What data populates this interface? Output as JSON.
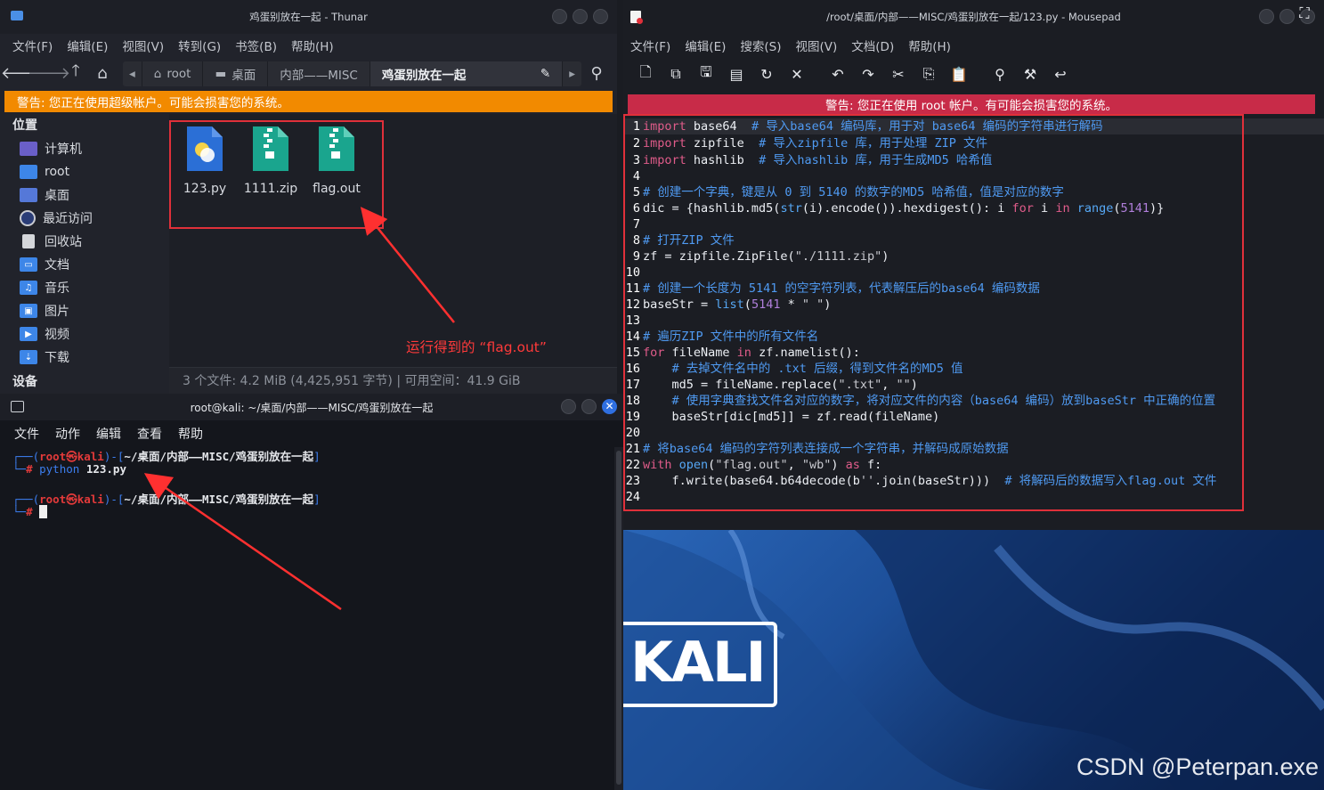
{
  "thunar": {
    "title": "鸡蛋别放在一起 - Thunar",
    "menu": [
      "文件(F)",
      "编辑(E)",
      "视图(V)",
      "转到(G)",
      "书签(B)",
      "帮助(H)"
    ],
    "breadcrumbs": [
      "root",
      "桌面",
      "内部——MISC",
      "鸡蛋别放在一起"
    ],
    "warning": "警告: 您正在使用超级帐户。可能会损害您的系统。",
    "places_header": "位置",
    "places": [
      "计算机",
      "root",
      "桌面",
      "最近访问",
      "回收站",
      "文档",
      "音乐",
      "图片",
      "视频",
      "下载"
    ],
    "devices_header": "设备",
    "files": [
      "123.py",
      "1111.zip",
      "flag.out"
    ],
    "status": "3 个文件: 4.2 MiB (4,425,951 字节)  |  可用空间：41.9 GiB",
    "annotation": "运行得到的 “flag.out”"
  },
  "mousepad": {
    "title": "/root/桌面/内部——MISC/鸡蛋别放在一起/123.py - Mousepad",
    "menu": [
      "文件(F)",
      "编辑(E)",
      "搜索(S)",
      "视图(V)",
      "文档(D)",
      "帮助(H)"
    ],
    "warning": "警告: 您正在使用 root 帐户。有可能会损害您的系统。",
    "line_numbers": [
      "1",
      "2",
      "3",
      "4",
      "5",
      "6",
      "7",
      "8",
      "9",
      "10",
      "11",
      "12",
      "13",
      "14",
      "15",
      "16",
      "17",
      "18",
      "19",
      "20",
      "21",
      "22",
      "23",
      "24"
    ],
    "code": {
      "l1": {
        "kw": "import",
        "rest": " base64  ",
        "cm": "# 导入base64 编码库，用于对 base64 编码的字符串进行解码"
      },
      "l2": {
        "kw": "import",
        "rest": " zipfile  ",
        "cm": "# 导入zipfile 库，用于处理 ZIP 文件"
      },
      "l3": {
        "kw": "import",
        "rest": " hashlib  ",
        "cm": "# 导入hashlib 库，用于生成MD5 哈希值"
      },
      "l5": {
        "cm": "# 创建一个字典，键是从 0 到 5140 的数字的MD5 哈希值，值是对应的数字"
      },
      "l6": {
        "a": "dic = {hashlib.md5(",
        "fn1": "str",
        "b": "(i).encode()).hexdigest(): i ",
        "kw1": "for",
        "c": " i ",
        "kw2": "in",
        "d": " ",
        "fn2": "range",
        "e": "(",
        "num": "5141",
        "f": ")}"
      },
      "l8": {
        "cm": "# 打开ZIP 文件"
      },
      "l9": {
        "a": "zf = zipfile.ZipFile(",
        "st": "\"./1111.zip\"",
        "b": ")"
      },
      "l11": {
        "cm": "# 创建一个长度为 5141 的空字符列表，代表解压后的base64 编码数据"
      },
      "l12": {
        "a": "baseStr = ",
        "fn": "list",
        "b": "(",
        "num": "5141",
        "c": " * ",
        "st": "\" \"",
        "d": ")"
      },
      "l14": {
        "cm": "# 遍历ZIP 文件中的所有文件名"
      },
      "l15": {
        "kw1": "for",
        "a": " fileName ",
        "kw2": "in",
        "b": " zf.namelist():"
      },
      "l16": {
        "cm": "    # 去掉文件名中的 .txt 后缀，得到文件名的MD5 值"
      },
      "l17": {
        "a": "    md5 = fileName.replace(",
        "st1": "\".txt\"",
        "b": ", ",
        "st2": "\"\"",
        "c": ")"
      },
      "l18": {
        "cm": "    # 使用字典查找文件名对应的数字，将对应文件的内容（base64 编码）放到baseStr 中正确的位置"
      },
      "l19": {
        "a": "    baseStr[dic[md5]] = zf.read(fileName)"
      },
      "l21": {
        "cm": "# 将base64 编码的字符列表连接成一个字符串，并解码成原始数据"
      },
      "l22": {
        "kw1": "with",
        "a": " ",
        "fn": "open",
        "b": "(",
        "st1": "\"flag.out\"",
        "c": ", ",
        "st2": "\"wb\"",
        "d": ") ",
        "kw2": "as",
        "e": " f:"
      },
      "l23": {
        "a": "    f.write(base64.b64decode(b",
        "st": "''",
        "b": ".join(baseStr)))  ",
        "cm": "# 将解码后的数据写入flag.out 文件"
      }
    }
  },
  "terminal": {
    "title": "root@kali: ~/桌面/内部——MISC/鸡蛋别放在一起",
    "menu": [
      "文件",
      "动作",
      "编辑",
      "查看",
      "帮助"
    ],
    "prompt_user": "root㉿kali",
    "prompt_path": "~/桌面/内部——MISC/鸡蛋别放在一起",
    "command_word": "python",
    "command_arg": "123.py"
  },
  "wallpaper": {
    "logo_text": "KALI",
    "watermark": "CSDN @Peterpan.exe"
  }
}
